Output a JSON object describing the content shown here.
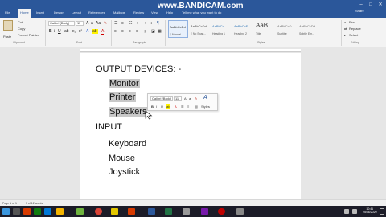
{
  "app": {
    "watermark": "www.BANDICAM.com",
    "tell_me": "Tell me what you want to do",
    "share": "Share"
  },
  "ribbon": {
    "tabs": [
      "File",
      "Home",
      "Insert",
      "Design",
      "Layout",
      "References",
      "Mailings",
      "Review",
      "View",
      "Help"
    ],
    "active_tab": "Home",
    "clipboard": {
      "cut": "Cut",
      "copy": "Copy",
      "format_painter": "Format Painter",
      "paste": "Paste",
      "label": "Clipboard"
    },
    "font": {
      "name": "Calibri (Body)",
      "size": "11",
      "label": "Font"
    },
    "paragraph_label": "Paragraph",
    "styles": [
      {
        "sample": "AaBbCcDd",
        "name": "¶ Normal"
      },
      {
        "sample": "AaBbCcDd",
        "name": "¶ No Spac..."
      },
      {
        "sample": "AaBbCc",
        "name": "Heading 1"
      },
      {
        "sample": "AaBbCcE",
        "name": "Heading 2"
      },
      {
        "sample": "AaB",
        "name": "Title"
      },
      {
        "sample": "AaBbCcD",
        "name": "Subtitle"
      },
      {
        "sample": "AaBbCcDd",
        "name": "Subtle Em..."
      }
    ],
    "styles_label": "Styles",
    "editing": {
      "find": "Find",
      "replace": "Replace",
      "select": "Select",
      "label": "Editing"
    }
  },
  "document": {
    "lines": [
      {
        "text": "OUTPUT DEVICES: -",
        "indent": false,
        "selected": false
      },
      {
        "text": "Monitor",
        "indent": true,
        "selected": true
      },
      {
        "text": "Printer",
        "indent": true,
        "selected": true
      },
      {
        "text": "Speakers",
        "indent": true,
        "selected": true
      },
      {
        "text": "INPUT",
        "indent": false,
        "selected": false
      },
      {
        "text": "Keyboard",
        "indent": true,
        "selected": false
      },
      {
        "text": "Mouse",
        "indent": true,
        "selected": false
      },
      {
        "text": "Joystick",
        "indent": true,
        "selected": false
      }
    ]
  },
  "mini_toolbar": {
    "font": "Calibri (Body)",
    "size": "11",
    "styles_label": "Styles"
  },
  "status": {
    "page": "Page 1 of 1",
    "words": "3 of 12 words"
  },
  "clock": {
    "time": "10:41",
    "date": "25/06/2020"
  }
}
